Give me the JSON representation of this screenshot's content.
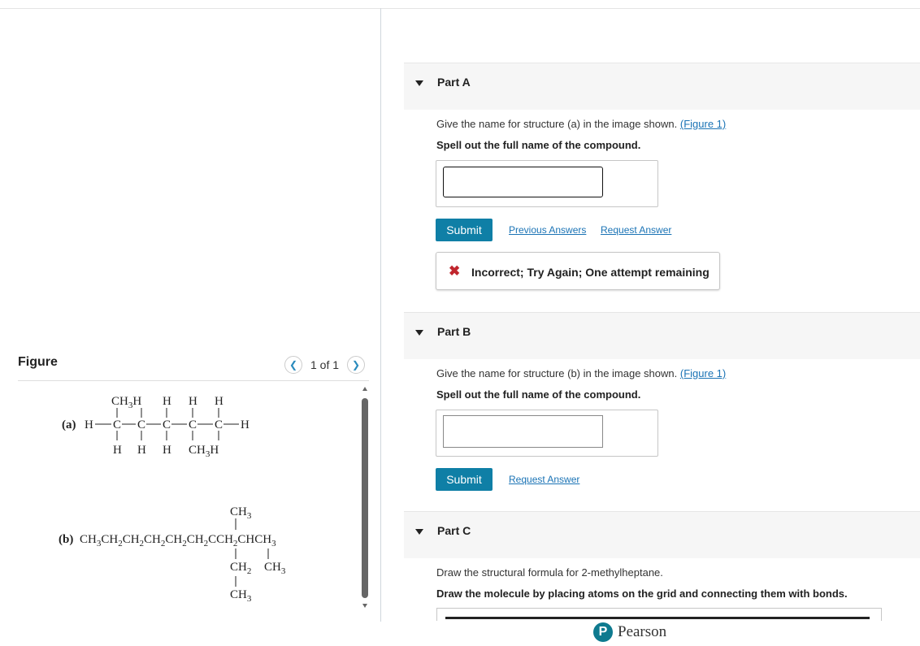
{
  "figure": {
    "title": "Figure",
    "pager": "1 of 1",
    "structure_a": {
      "label": "(a)",
      "top_row": [
        "CH3H",
        "H",
        "H",
        "H"
      ],
      "middle_row": [
        "H",
        "C",
        "C",
        "C",
        "C",
        "C",
        "H"
      ],
      "bottom_row": [
        "H",
        "H",
        "H",
        "CH3H"
      ]
    },
    "structure_b": {
      "label": "(b)",
      "main_chain": "CH3CH2CH2CH2CH2CH2CCH2CHCH3",
      "top_substituent": "CH3",
      "branch_1": "CH2",
      "branch_1_end": "CH3",
      "branch_2": "CH3"
    }
  },
  "parts": [
    {
      "title": "Part A",
      "question": "Give the name for structure (a) in the image shown.",
      "figure_link": "(Figure 1)",
      "instruction": "Spell out the full name of the compound.",
      "answer_value": "",
      "submit_label": "Submit",
      "previous_answers_label": "Previous Answers",
      "request_answer_label": "Request Answer",
      "feedback": "Incorrect; Try Again; One attempt remaining"
    },
    {
      "title": "Part B",
      "question": "Give the name for structure (b) in the image shown.",
      "figure_link": "(Figure 1)",
      "instruction": "Spell out the full name of the compound.",
      "answer_value": "",
      "submit_label": "Submit",
      "request_answer_label": "Request Answer"
    },
    {
      "title": "Part C",
      "question": "Draw the structural formula for 2-methylheptane.",
      "instruction": "Draw the molecule by placing atoms on the grid and connecting them with bonds."
    }
  ],
  "footer": {
    "brand": "Pearson",
    "logo_letter": "P"
  },
  "colors": {
    "accent": "#0f7fa6",
    "link": "#1a73b5",
    "error": "#c0262d"
  }
}
